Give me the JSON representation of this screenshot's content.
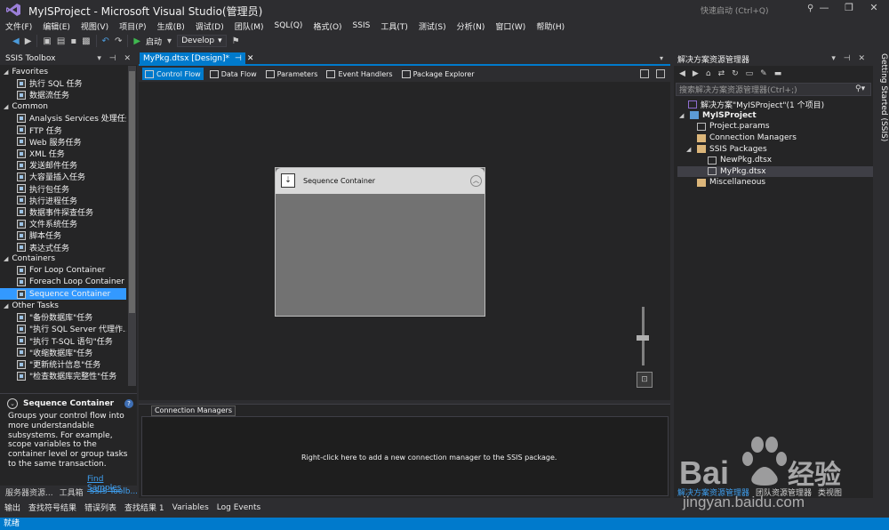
{
  "titlebar": {
    "title": "MyISProject - Microsoft Visual Studio(管理员)",
    "quick_launch_placeholder": "快速启动 (Ctrl+Q)"
  },
  "menu": [
    "文件(F)",
    "编辑(E)",
    "视图(V)",
    "项目(P)",
    "生成(B)",
    "调试(D)",
    "团队(M)",
    "SQL(Q)",
    "格式(O)",
    "SSIS",
    "工具(T)",
    "测试(S)",
    "分析(N)",
    "窗口(W)",
    "帮助(H)"
  ],
  "toolbar": {
    "start_label": "启动",
    "configuration": "Develop"
  },
  "toolbox": {
    "title": "SSIS Toolbox",
    "categories": [
      {
        "name": "Favorites",
        "items": [
          "执行 SQL 任务",
          "数据流任务"
        ]
      },
      {
        "name": "Common",
        "items": [
          "Analysis Services 处理任务",
          "FTP 任务",
          "Web 服务任务",
          "XML 任务",
          "发送邮件任务",
          "大容量插入任务",
          "执行包任务",
          "执行进程任务",
          "数据事件探查任务",
          "文件系统任务",
          "脚本任务",
          "表达式任务"
        ]
      },
      {
        "name": "Containers",
        "items": [
          "For Loop Container",
          "Foreach Loop Container",
          "Sequence Container"
        ]
      },
      {
        "name": "Other Tasks",
        "items": [
          "\"备份数据库\"任务",
          "\"执行 SQL Server 代理作...",
          "\"执行 T-SQL 语句\"任务",
          "\"收缩数据库\"任务",
          "\"更新统计信息\"任务",
          "\"检查数据库完整性\"任务"
        ]
      }
    ],
    "selected_item": "Sequence Container",
    "info": {
      "title": "Sequence Container",
      "description": "Groups your control flow into more understandable subsystems. For example, scope variables to the container level or group tasks to the same transaction.",
      "link": "Find Samples"
    },
    "bottom_tabs": [
      "服务器资源...",
      "工具箱",
      "SSIS Toolb..."
    ]
  },
  "document": {
    "tab_label": "MyPkg.dtsx [Design]*",
    "designer_tabs": [
      "Control Flow",
      "Data Flow",
      "Parameters",
      "Event Handlers",
      "Package Explorer"
    ],
    "active_designer_tab": "Control Flow",
    "container_title": "Sequence Container",
    "connection_managers_tab": "Connection Managers",
    "connection_hint": "Right-click here to add a new connection manager to the SSIS package."
  },
  "solution_explorer": {
    "title": "解决方案资源管理器",
    "search_placeholder": "搜索解决方案资源管理器(Ctrl+;)",
    "tree": [
      {
        "label": "解决方案\"MyISProject\"(1 个项目)",
        "level": 0
      },
      {
        "label": "MyISProject",
        "level": 1
      },
      {
        "label": "Project.params",
        "level": 2
      },
      {
        "label": "Connection Managers",
        "level": 2
      },
      {
        "label": "SSIS Packages",
        "level": 2
      },
      {
        "label": "NewPkg.dtsx",
        "level": 3
      },
      {
        "label": "MyPkg.dtsx",
        "level": 3
      },
      {
        "label": "Miscellaneous",
        "level": 2
      }
    ],
    "bottom_tabs": [
      "解决方案资源管理器",
      "团队资源管理器",
      "类视图"
    ]
  },
  "side_strip": "Getting Started (SSIS)",
  "output_tabs": [
    "输出",
    "查找符号结果",
    "错误列表",
    "查找结果 1",
    "Variables",
    "Log Events"
  ],
  "status": "就绪",
  "watermark": {
    "brand": "Baidu经验",
    "url": "jingyan.baidu.com"
  }
}
